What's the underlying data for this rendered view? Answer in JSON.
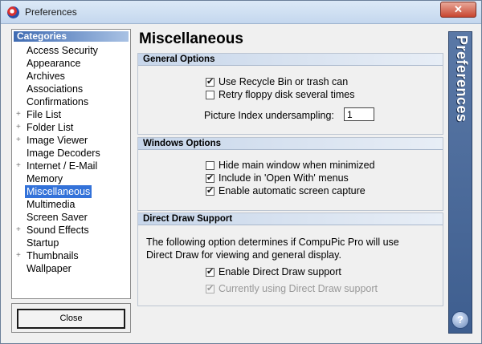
{
  "window": {
    "title": "Preferences",
    "close_glyph": "✕"
  },
  "categories": {
    "header": "Categories",
    "items": [
      {
        "label": "Access Security",
        "expandable": false,
        "selected": false
      },
      {
        "label": "Appearance",
        "expandable": false,
        "selected": false
      },
      {
        "label": "Archives",
        "expandable": false,
        "selected": false
      },
      {
        "label": "Associations",
        "expandable": false,
        "selected": false
      },
      {
        "label": "Confirmations",
        "expandable": false,
        "selected": false
      },
      {
        "label": "File List",
        "expandable": true,
        "selected": false
      },
      {
        "label": "Folder List",
        "expandable": true,
        "selected": false
      },
      {
        "label": "Image Viewer",
        "expandable": true,
        "selected": false
      },
      {
        "label": "Image Decoders",
        "expandable": false,
        "selected": false
      },
      {
        "label": "Internet / E-Mail",
        "expandable": true,
        "selected": false
      },
      {
        "label": "Memory",
        "expandable": false,
        "selected": false
      },
      {
        "label": "Miscellaneous",
        "expandable": false,
        "selected": true
      },
      {
        "label": "Multimedia",
        "expandable": false,
        "selected": false
      },
      {
        "label": "Screen Saver",
        "expandable": false,
        "selected": false
      },
      {
        "label": "Sound Effects",
        "expandable": true,
        "selected": false
      },
      {
        "label": "Startup",
        "expandable": false,
        "selected": false
      },
      {
        "label": "Thumbnails",
        "expandable": true,
        "selected": false
      },
      {
        "label": "Wallpaper",
        "expandable": false,
        "selected": false
      }
    ],
    "expand_glyph": "+"
  },
  "close_button": "Close",
  "main": {
    "title": "Miscellaneous",
    "general": {
      "header": "General Options",
      "recycle_label": "Use Recycle Bin or trash can",
      "recycle_checked": true,
      "floppy_label": "Retry floppy disk several times",
      "floppy_checked": false,
      "undersampling_label": "Picture Index undersampling:",
      "undersampling_value": "1"
    },
    "windows": {
      "header": "Windows Options",
      "hide_label": "Hide main window when minimized",
      "hide_checked": false,
      "openwith_label": "Include in 'Open With' menus",
      "openwith_checked": true,
      "capture_label": "Enable automatic screen capture",
      "capture_checked": true
    },
    "directdraw": {
      "header": "Direct Draw Support",
      "desc_line1": "The following option determines if CompuPic Pro will use",
      "desc_line2": "Direct Draw for viewing and general display.",
      "enable_label": "Enable Direct Draw support",
      "enable_checked": true,
      "current_label": "Currently using Direct Draw support",
      "current_checked": true
    }
  },
  "banner": {
    "text": "Preferences",
    "help_glyph": "?"
  }
}
